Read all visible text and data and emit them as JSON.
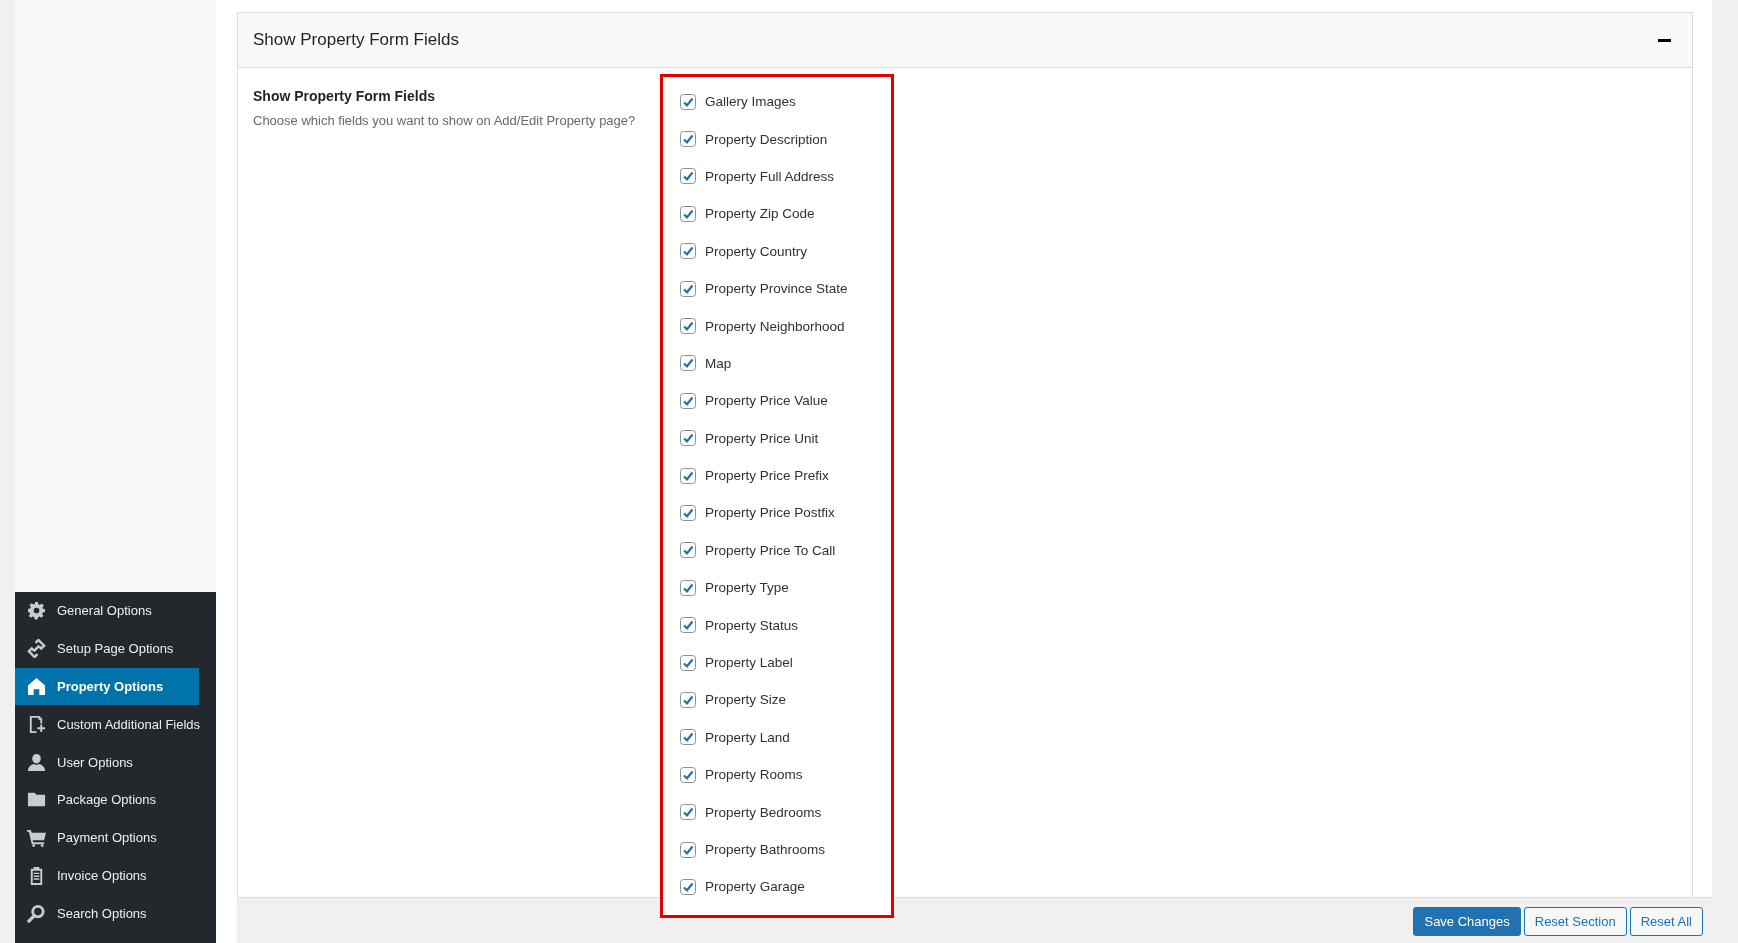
{
  "sidebar": {
    "items": [
      {
        "label": "General Options",
        "selected": false
      },
      {
        "label": "Setup Page Options",
        "selected": false
      },
      {
        "label": "Property Options",
        "selected": true
      },
      {
        "label": "Custom Additional Fields",
        "selected": false
      },
      {
        "label": "User Options",
        "selected": false
      },
      {
        "label": "Package Options",
        "selected": false
      },
      {
        "label": "Payment Options",
        "selected": false
      },
      {
        "label": "Invoice Options",
        "selected": false
      },
      {
        "label": "Search Options",
        "selected": false
      }
    ]
  },
  "panel": {
    "title": "Show Property Form Fields",
    "expanded": true
  },
  "setting": {
    "label": "Show Property Form Fields",
    "description": "Choose which fields you want to show on Add/Edit Property page?"
  },
  "fields": [
    {
      "label": "Gallery Images",
      "checked": true
    },
    {
      "label": "Property Description",
      "checked": true
    },
    {
      "label": "Property Full Address",
      "checked": true
    },
    {
      "label": "Property Zip Code",
      "checked": true
    },
    {
      "label": "Property Country",
      "checked": true
    },
    {
      "label": "Property Province State",
      "checked": true
    },
    {
      "label": "Property Neighborhood",
      "checked": true
    },
    {
      "label": "Map",
      "checked": true
    },
    {
      "label": "Property Price Value",
      "checked": true
    },
    {
      "label": "Property Price Unit",
      "checked": true
    },
    {
      "label": "Property Price Prefix",
      "checked": true
    },
    {
      "label": "Property Price Postfix",
      "checked": true
    },
    {
      "label": "Property Price To Call",
      "checked": true
    },
    {
      "label": "Property Type",
      "checked": true
    },
    {
      "label": "Property Status",
      "checked": true
    },
    {
      "label": "Property Label",
      "checked": true
    },
    {
      "label": "Property Size",
      "checked": true
    },
    {
      "label": "Property Land",
      "checked": true
    },
    {
      "label": "Property Rooms",
      "checked": true
    },
    {
      "label": "Property Bedrooms",
      "checked": true
    },
    {
      "label": "Property Bathrooms",
      "checked": true
    },
    {
      "label": "Property Garage",
      "checked": true
    }
  ],
  "buttons": [
    {
      "label": "Save Changes",
      "kind": "primary"
    },
    {
      "label": "Reset Section",
      "kind": "secondary"
    },
    {
      "label": "Reset All",
      "kind": "secondary"
    }
  ]
}
